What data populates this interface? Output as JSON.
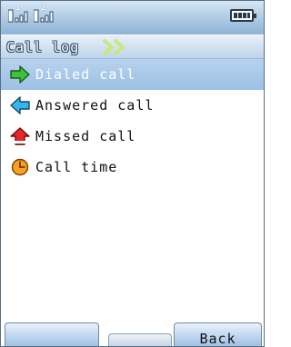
{
  "status_bar": {
    "sim1": "1",
    "sim2": "2"
  },
  "title": "Call log",
  "menu": [
    {
      "label": "Dialed call",
      "icon": "green-right-arrow-icon"
    },
    {
      "label": "Answered call",
      "icon": "blue-left-arrow-icon"
    },
    {
      "label": "Missed call",
      "icon": "red-up-arrow-icon"
    },
    {
      "label": "Call time",
      "icon": "clock-icon"
    }
  ],
  "softkeys": {
    "left": "",
    "center": "",
    "right": "Back"
  },
  "colors": {
    "selected_row": "#a9c8e8",
    "bar_accent": "#9ec1e3"
  }
}
